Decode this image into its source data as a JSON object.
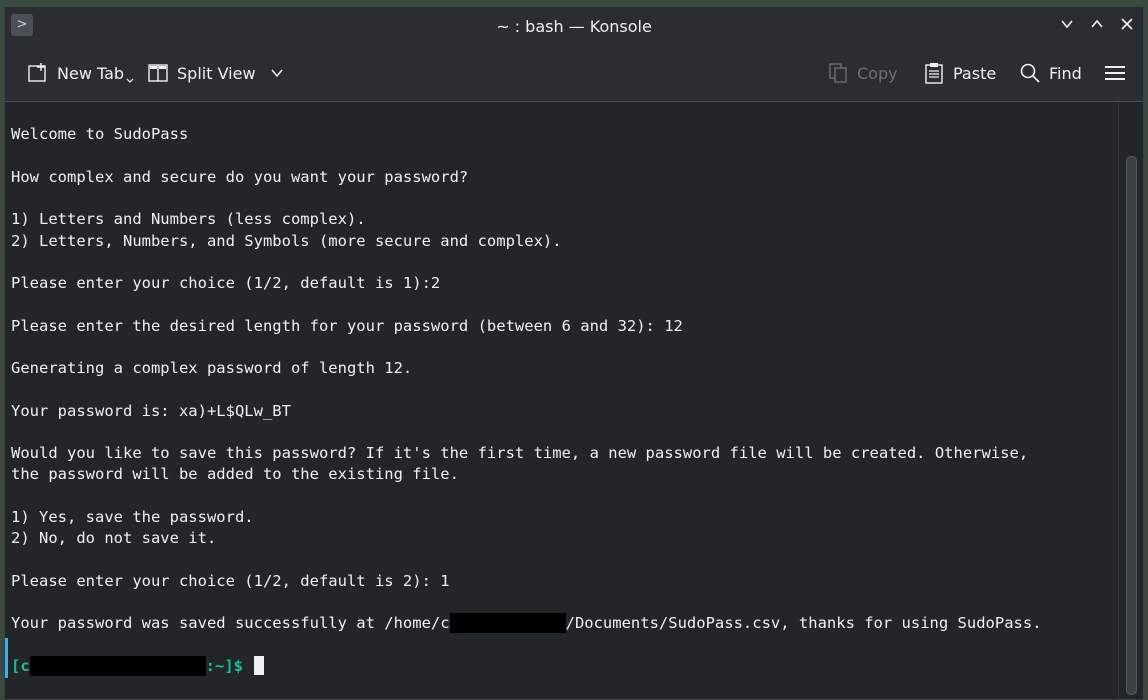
{
  "window": {
    "title": "~ : bash — Konsole",
    "app_menu_glyph": ">",
    "controls": {
      "minimize": "⌄",
      "maximize": "⌃",
      "close": "✕"
    }
  },
  "toolbar": {
    "new_tab_label": "New Tab",
    "split_view_label": "Split View",
    "copy_label": "Copy",
    "paste_label": "Paste",
    "find_label": "Find",
    "icons": {
      "new_tab": "new-tab-icon",
      "split_view": "split-view-icon",
      "copy": "copy-icon",
      "paste": "paste-icon",
      "find": "search-icon",
      "menu": "hamburger-menu-icon"
    }
  },
  "terminal": {
    "lines": [
      "Welcome to SudoPass",
      "How complex and secure do you want your password?",
      "1) Letters and Numbers (less complex).",
      "2) Letters, Numbers, and Symbols (more secure and complex).",
      "Please enter your choice (1/2, default is 1):2",
      "Please enter the desired length for your password (between 6 and 32): 12",
      "Generating a complex password of length 12.",
      "Your password is: xa)+L$QLw_BT",
      "Would you like to save this password? If it's the first time, a new password file will be created. Otherwise,",
      "the password will be added to the existing file.",
      "1) Yes, save the password.",
      "2) No, do not save it.",
      "Please enter your choice (1/2, default is 2): 1"
    ],
    "saved_line_prefix": "Your password was saved successfully at /home/c",
    "saved_line_suffix": "/Documents/SudoPass.csv, thanks for using SudoPass.",
    "prompt_prefix": "[c",
    "prompt_suffix": ":~]$"
  },
  "colors": {
    "background": "#232629",
    "text": "#eff0f1",
    "prompt": "#1abc9c",
    "accent": "#3daee9"
  }
}
